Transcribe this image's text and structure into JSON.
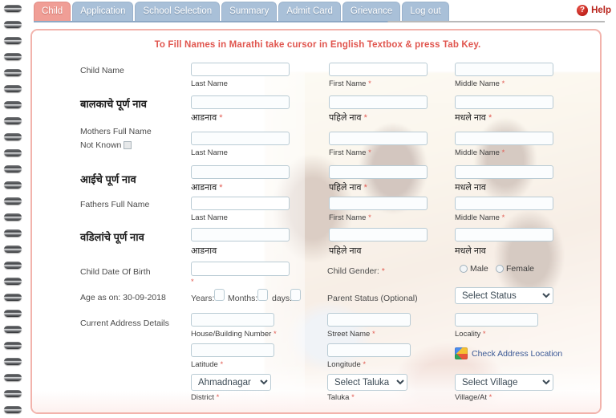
{
  "nav": {
    "tabs": [
      {
        "label": "Child",
        "active": true
      },
      {
        "label": "Application",
        "active": false
      },
      {
        "label": "School Selection",
        "active": false
      },
      {
        "label": "Summary",
        "active": false
      },
      {
        "label": "Admit Card",
        "active": false
      },
      {
        "label": "Grievance",
        "active": false
      },
      {
        "label": "Log out",
        "active": false
      }
    ],
    "help_label": "Help",
    "help_icon": "question-mark-icon"
  },
  "form": {
    "notice": "To Fill Names in Marathi take cursor in English Textbox & press Tab Key.",
    "child_name_label": "Child Name",
    "child_name_label_mr": "बालकाचे पूर्ण नाव",
    "mother_name_label": "Mothers Full Name",
    "mother_not_known_label": "Not Known",
    "mother_name_label_mr": "आईचे पूर्ण नाव",
    "father_name_label": "Fathers Full Name",
    "father_name_label_mr": "वडिलांचे पूर्ण नाव",
    "sub_last": "Last Name",
    "sub_first": "First Name",
    "sub_middle": "Middle Name",
    "sub_last_mr": "आडनाव",
    "sub_first_mr": "पहिले नाव",
    "sub_middle_mr": "मधले नाव",
    "dob_label": "Child Date Of Birth",
    "gender_label": "Child Gender:",
    "gender_male": "Male",
    "gender_female": "Female",
    "age_label": "Age as on: 30-09-2018",
    "age_years": "Years:",
    "age_months": "Months:",
    "age_days": "days:",
    "parent_status_label": "Parent Status (Optional)",
    "parent_status_value": "Select Status",
    "address_label": "Current Address Details",
    "sub_house": "House/Building Number",
    "sub_street": "Street Name",
    "sub_locality": "Locality",
    "sub_latitude": "Latitude",
    "sub_longitude": "Longitude",
    "check_location_label": "Check Address Location",
    "check_location_icon": "google-maps-icon",
    "district_value": "Ahmadnagar",
    "sub_district": "District",
    "taluka_value": "Select Taluka",
    "sub_taluka": "Taluka",
    "village_value": "Select Village",
    "sub_village": "Village/At",
    "values": {
      "child_last": "",
      "child_first": "",
      "child_middle": "",
      "child_last_mr": "",
      "child_first_mr": "",
      "child_middle_mr": "",
      "mother_last": "",
      "mother_first": "",
      "mother_middle": "",
      "mother_last_mr": "",
      "mother_first_mr": "",
      "mother_middle_mr": "",
      "father_last": "",
      "father_first": "",
      "father_middle": "",
      "father_last_mr": "",
      "father_first_mr": "",
      "father_middle_mr": "",
      "dob": "",
      "years": "",
      "months": "",
      "days": "",
      "house": "",
      "street": "",
      "locality": "",
      "latitude": "",
      "longitude": ""
    }
  },
  "colors": {
    "active_tab": "#f09e96",
    "inactive_tab": "#a9c0d8",
    "notice_text": "#e0554e",
    "panel_border": "#f2b3ac",
    "required_mark": "#e25b52",
    "link": "#3c5a96",
    "help_text": "#b8231b"
  }
}
